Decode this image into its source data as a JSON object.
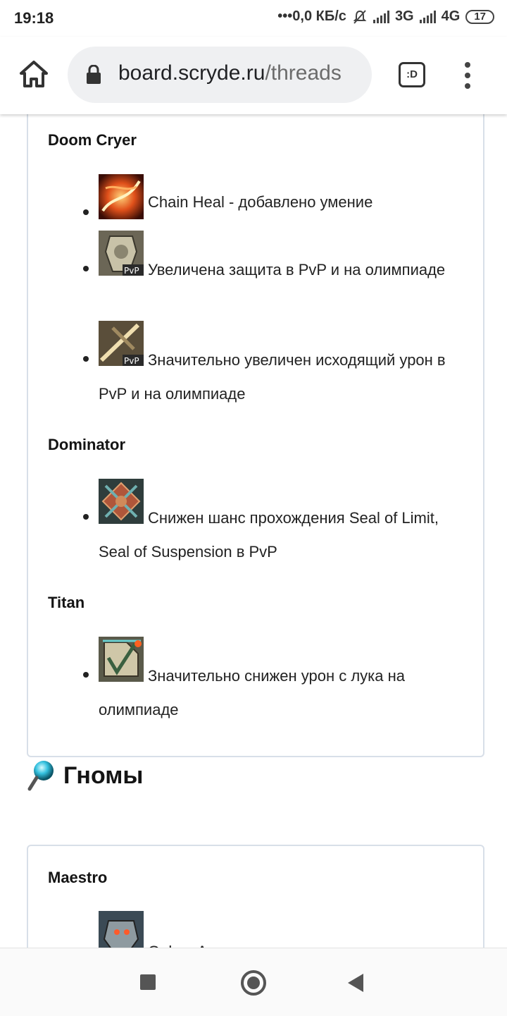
{
  "status": {
    "time": "19:18",
    "net_speed": "•••0,0 КБ/с",
    "net1": "3G",
    "net2": "4G",
    "battery": "17"
  },
  "browser": {
    "url_domain": "board.scryde.ru",
    "url_path": "/threads",
    "tabs_label": ":D"
  },
  "sections": [
    {
      "class": "Doom Cryer",
      "items": [
        {
          "icon": "chain-heal-skill-icon",
          "text": "Chain Heal - добавлено умение"
        },
        {
          "icon": "pvp-defense-skill-icon",
          "text": "Увеличена защита в PvP и на олимпиаде"
        },
        {
          "icon": "pvp-attack-skill-icon",
          "text": "Значительно увеличен исходящий урон в PvP и на олимпиаде"
        }
      ]
    },
    {
      "class": "Dominator",
      "items": [
        {
          "icon": "seal-skill-icon",
          "text": "Снижен шанс прохождения Seal of Limit, Seal of Suspension в PvP"
        }
      ]
    },
    {
      "class": "Titan",
      "items": [
        {
          "icon": "bow-defense-skill-icon",
          "text": "Значительно снижен урон с лука на олимпиаде"
        }
      ]
    }
  ],
  "race": {
    "title": "Гномы",
    "icon": "pin-icon"
  },
  "section2": {
    "class": "Maestro",
    "first_item": {
      "icon": "golem-armor-skill-icon",
      "text": "Golem Armor - откат уменьшен в два"
    }
  }
}
